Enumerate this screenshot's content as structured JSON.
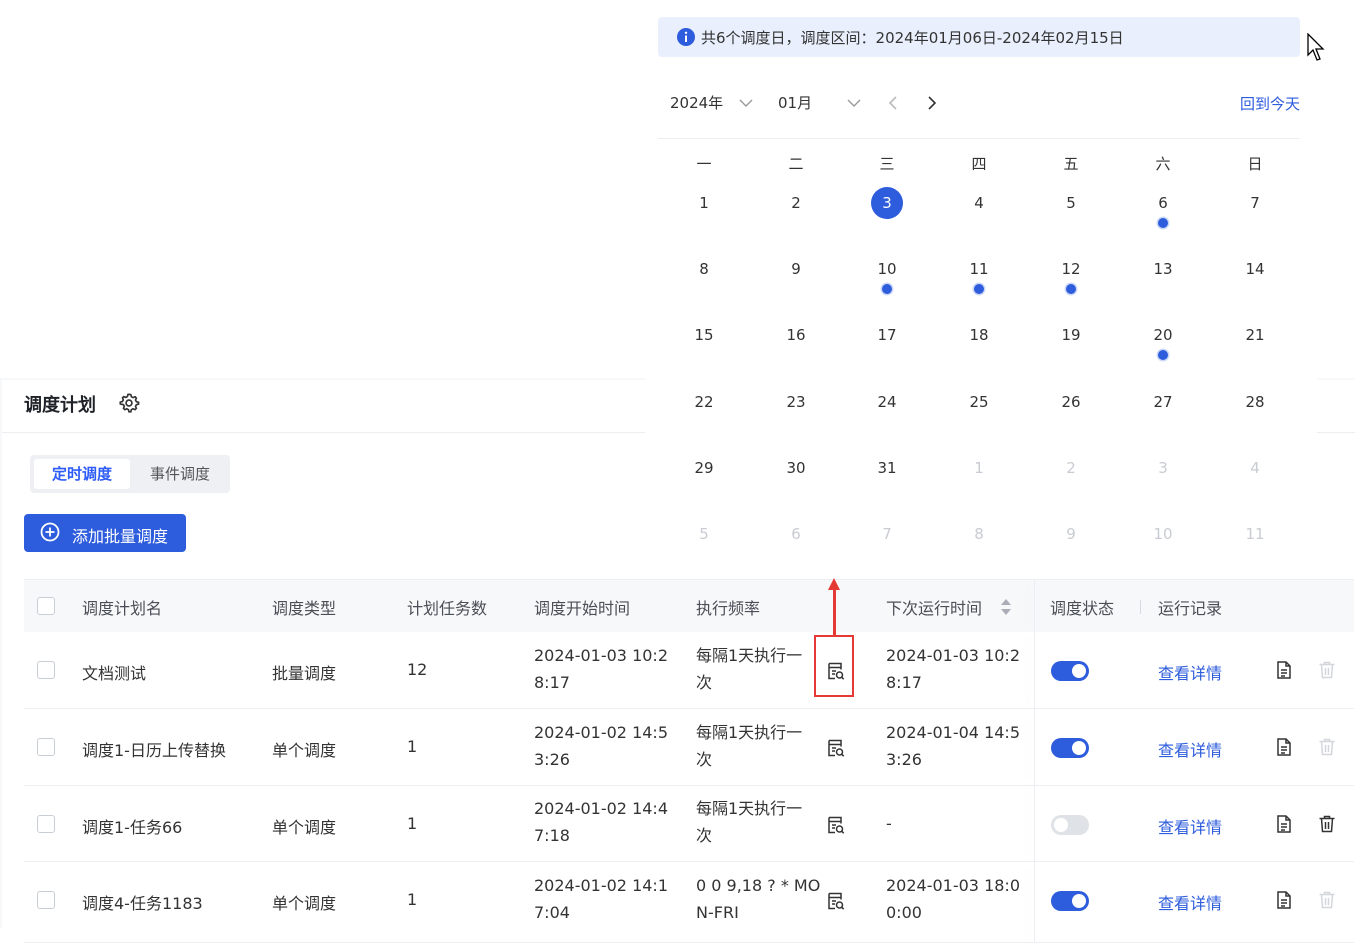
{
  "colors": {
    "accent": "#2d5cdc",
    "highlight": "#e53935"
  },
  "page": {
    "title": "调度计划",
    "tabs": [
      {
        "label": "定时调度",
        "active": true
      },
      {
        "label": "事件调度",
        "active": false
      }
    ],
    "add_button": "添加批量调度"
  },
  "table": {
    "headers": {
      "name": "调度计划名",
      "type": "调度类型",
      "count": "计划任务数",
      "start": "调度开始时间",
      "freq": "执行频率",
      "next": "下次运行时间",
      "status": "调度状态",
      "record": "运行记录"
    },
    "rows": [
      {
        "name": "文档测试",
        "type": "批量调度",
        "count": "12",
        "start_1": "2024-01-03 10:2",
        "start_2": "8:17",
        "freq_1": "每隔1天执行一",
        "freq_2": "次",
        "next_1": "2024-01-03 10:2",
        "next_2": "8:17",
        "enabled": true,
        "record": "查看详情",
        "delete_enabled": false
      },
      {
        "name": "调度1-日历上传替换",
        "type": "单个调度",
        "count": "1",
        "start_1": "2024-01-02 14:5",
        "start_2": "3:26",
        "freq_1": "每隔1天执行一",
        "freq_2": "次",
        "next_1": "2024-01-04 14:5",
        "next_2": "3:26",
        "enabled": true,
        "record": "查看详情",
        "delete_enabled": false
      },
      {
        "name": "调度1-任务66",
        "type": "单个调度",
        "count": "1",
        "start_1": "2024-01-02 14:4",
        "start_2": "7:18",
        "freq_1": "每隔1天执行一",
        "freq_2": "次",
        "next_1": "-",
        "next_2": "",
        "enabled": false,
        "record": "查看详情",
        "delete_enabled": true
      },
      {
        "name": "调度4-任务1183",
        "type": "单个调度",
        "count": "1",
        "start_1": "2024-01-02 14:1",
        "start_2": "7:04",
        "freq_1": "0 0 9,18 ? * MO",
        "freq_2": "N-FRI",
        "next_1": "2024-01-03 18:0",
        "next_2": "0:00",
        "enabled": true,
        "record": "查看详情",
        "delete_enabled": false
      }
    ]
  },
  "calendar": {
    "info": "共6个调度日，调度区间：2024年01月06日-2024年02月15日",
    "year": "2024年",
    "month": "01月",
    "today_button": "回到今天",
    "weekdays": [
      "一",
      "二",
      "三",
      "四",
      "五",
      "六",
      "日"
    ],
    "days": [
      "1",
      "2",
      "3",
      "4",
      "5",
      "6",
      "7",
      "8",
      "9",
      "10",
      "11",
      "12",
      "13",
      "14",
      "15",
      "16",
      "17",
      "18",
      "19",
      "20",
      "21",
      "22",
      "23",
      "24",
      "25",
      "26",
      "27",
      "28",
      "29",
      "30",
      "31",
      "1",
      "2",
      "3",
      "4",
      "5",
      "6",
      "7",
      "8",
      "9",
      "10",
      "11"
    ],
    "today_index": 2,
    "scheduled_indices": [
      5,
      9,
      10,
      11,
      19
    ],
    "outside_month_indices": [
      31,
      32,
      33,
      34,
      35,
      36,
      37,
      38,
      39,
      40,
      41
    ]
  }
}
